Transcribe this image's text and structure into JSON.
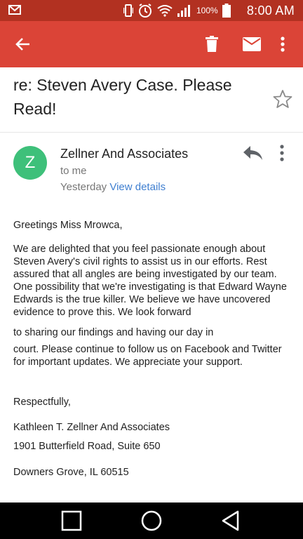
{
  "status_bar": {
    "battery_percent": "100%",
    "time": "8:00 AM"
  },
  "email": {
    "subject": "re: Steven Avery Case. Please Read!",
    "sender": {
      "avatar_letter": "Z",
      "avatar_color": "#3ec07a",
      "name": "Zellner And Associates",
      "recipient": "to me",
      "date": "Yesterday",
      "view_details": "View details"
    },
    "body": {
      "greeting": "Greetings Miss Mrowca,",
      "para_a": "We are delighted that you feel passionate enough about Steven Avery's civil rights to assist us in our efforts. Rest assured that all angles are being investigated by our team. One possibility that we're investigating is that Edward Wayne Edwards is the true killer. We believe we have uncovered evidence to prove this. We look forward",
      "para_b": "to sharing our findings and having our day in",
      "para_c": "court. Please continue to follow us on Facebook and Twitter for important updates. We appreciate your support.",
      "closing": "Respectfully,",
      "signature": "Kathleen T. Zellner And Associates",
      "address_1": "1901 Butterfield Road, Suite 650",
      "address_2": "Downers Grove, IL 60515"
    }
  },
  "colors": {
    "status_bar": "#b23121",
    "app_bar": "#db4437",
    "link": "#3f7fd0"
  },
  "icons": [
    "back-arrow-icon",
    "trash-icon",
    "mail-icon",
    "more-vert-icon",
    "star-icon",
    "reply-icon",
    "square-nav-icon",
    "circle-nav-icon",
    "triangle-nav-icon"
  ]
}
